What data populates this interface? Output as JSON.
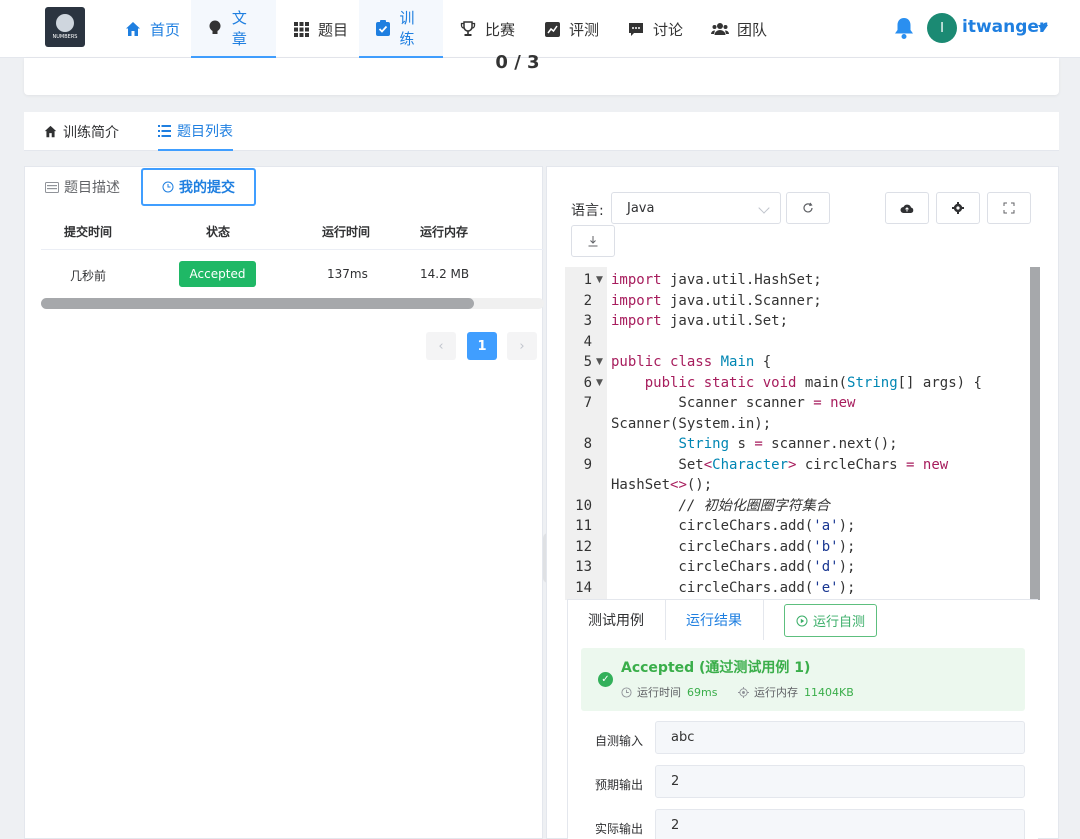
{
  "nav": {
    "logo_text": "NUMBERS",
    "items": [
      {
        "label": "首页",
        "icon": "home-icon"
      },
      {
        "label": "文章",
        "icon": "bulb-icon"
      },
      {
        "label": "题目",
        "icon": "grid-icon"
      },
      {
        "label": "训练",
        "icon": "clipboard-check-icon"
      },
      {
        "label": "比赛",
        "icon": "trophy-icon"
      },
      {
        "label": "评测",
        "icon": "chart-icon"
      },
      {
        "label": "讨论",
        "icon": "comment-icon"
      },
      {
        "label": "团队",
        "icon": "users-icon"
      }
    ],
    "avatar_letter": "I",
    "username": "itwanger"
  },
  "top_card": {
    "progress": "0 / 3"
  },
  "main_tabs": [
    {
      "label": "训练简介",
      "icon": "home-icon"
    },
    {
      "label": "题目列表",
      "icon": "list-icon"
    }
  ],
  "left": {
    "tabs": [
      {
        "label": "题目描述",
        "icon": "document-icon"
      },
      {
        "label": "我的提交",
        "icon": "clock-icon"
      }
    ],
    "columns": [
      "提交时间",
      "状态",
      "运行时间",
      "运行内存"
    ],
    "rows": [
      {
        "time": "几秒前",
        "status": "Accepted",
        "runtime": "137ms",
        "memory": "14.2 MB"
      }
    ],
    "pagination": {
      "current": "1",
      "prev": "‹",
      "next": "›"
    }
  },
  "right": {
    "language_label": "语言:",
    "language_value": "Java",
    "code_lines": [
      {
        "n": "1",
        "fold": true,
        "html": "<span class=\"kw\">import</span> java.util.HashSet;"
      },
      {
        "n": "2",
        "fold": false,
        "html": "<span class=\"kw\">import</span> java.util.Scanner;"
      },
      {
        "n": "3",
        "fold": false,
        "html": "<span class=\"kw\">import</span> java.util.Set;"
      },
      {
        "n": "4",
        "fold": false,
        "html": ""
      },
      {
        "n": "5",
        "fold": true,
        "html": "<span class=\"kw\">public</span> <span class=\"kw\">class</span> <span class=\"cls\">Main</span> {"
      },
      {
        "n": "6",
        "fold": true,
        "html": "    <span class=\"kw\">public</span> <span class=\"kw\">static</span> <span class=\"kw\">void</span> main(<span class=\"cls\">String</span>[] args) {"
      },
      {
        "n": "7",
        "fold": false,
        "html": "        Scanner scanner <span class=\"kw\">=</span> <span class=\"kw\">new</span>"
      },
      {
        "n": "",
        "fold": false,
        "html": "Scanner(System.in);"
      },
      {
        "n": "8",
        "fold": false,
        "html": "        <span class=\"cls\">String</span> s <span class=\"kw\">=</span> scanner.next();"
      },
      {
        "n": "9",
        "fold": false,
        "html": "        Set<span class=\"kw\">&lt;</span><span class=\"cls\">Character</span><span class=\"kw\">&gt;</span> circleChars <span class=\"kw\">=</span> <span class=\"kw\">new</span>"
      },
      {
        "n": "",
        "fold": false,
        "html": "HashSet<span class=\"kw\">&lt;&gt;</span>();"
      },
      {
        "n": "10",
        "fold": false,
        "html": "        <span class=\"cm\">// 初始化圈圈字符集合</span>"
      },
      {
        "n": "11",
        "fold": false,
        "html": "        circleChars.add(<span class=\"str\">'a'</span>);"
      },
      {
        "n": "12",
        "fold": false,
        "html": "        circleChars.add(<span class=\"str\">'b'</span>);"
      },
      {
        "n": "13",
        "fold": false,
        "html": "        circleChars.add(<span class=\"str\">'d'</span>);"
      },
      {
        "n": "14",
        "fold": false,
        "html": "        circleChars.add(<span class=\"str\">'e'</span>);"
      }
    ],
    "console": {
      "tab_testcase": "测试用例",
      "tab_result": "运行结果",
      "run_button": "运行自测",
      "result_title": "Accepted (通过测试用例 1)",
      "runtime_label": "运行时间",
      "runtime_value": "69ms",
      "memory_label": "运行内存",
      "memory_value": "11404KB",
      "input_label": "自测输入",
      "input_value": "abc",
      "expected_label": "预期输出",
      "expected_value": "2",
      "actual_label": "实际输出",
      "actual_value": "2"
    }
  },
  "colors": {
    "primary": "#409eff",
    "success": "#1fb866",
    "nav_active": "#1f7fe0"
  }
}
